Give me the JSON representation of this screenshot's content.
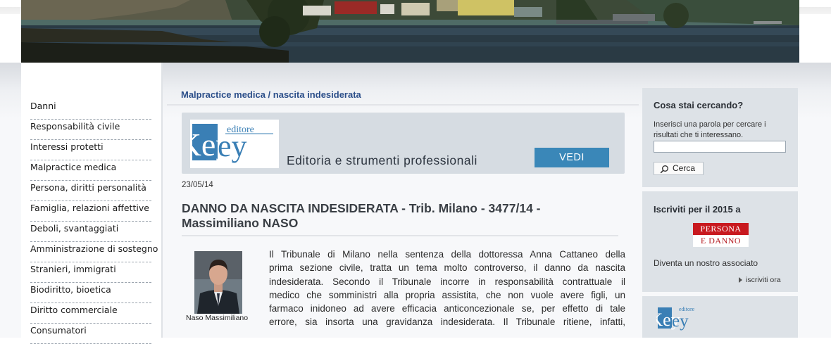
{
  "nav": {
    "items": [
      "Danni",
      "Responsabilità civile",
      "Interessi protetti",
      "Malpractice medica",
      "Persona, diritti personalità",
      "Famiglia, relazioni affettive",
      "Deboli, svantaggiati",
      "Amministrazione di sostegno",
      "Stranieri, immigrati",
      "Biodiritto, bioetica",
      "Diritto commerciale",
      "Consumatori"
    ]
  },
  "main": {
    "breadcrumb": "Malpractice medica / nascita indesiderata",
    "ad": {
      "logo_key": "Key",
      "logo_editore": "editore",
      "tagline": "Editoria e strumenti professionali",
      "button": "VEDI"
    },
    "date": "23/05/14",
    "title_line1": "DANNO DA NASCITA INDESIDERATA - Trib. Milano - 3477/14 -",
    "title_line2": "Massimiliano NASO",
    "photo_caption": "Naso Massimiliano",
    "body_lines": [
      "Il Tribunale di Milano nella sentenza della dottoressa Anna Cattaneo della",
      "prima sezione civile, tratta un tema molto controverso, il danno da nascita",
      "indesiderata. Secondo il Tribunale incorre in responsabilità contrattuale il",
      "medico che somministri alla propria assistita, che non vuole avere figli, un",
      "farmaco inidoneo ad avere efficacia anticoncezionale se, per effetto di tale",
      "errore, sia insorta una gravidanza indesiderata. Il Tribunale ritiene, infatti,"
    ]
  },
  "sidebar": {
    "search": {
      "title": "Cosa stai cercando?",
      "description": "Inserisci una parola per cercare i risultati che ti interessano.",
      "button": "Cerca",
      "value": ""
    },
    "subscribe": {
      "title": "Iscriviti per il 2015 a",
      "logo_top": "PERSONA",
      "logo_bottom": "E DANNO",
      "text": "Diventa un nostro associato",
      "link": "iscriviti ora"
    },
    "key_box": {
      "logo_key": "Key",
      "logo_editore": "editore"
    }
  },
  "colors": {
    "breadcrumb": "#2c4f8a",
    "ad_button": "#3a87b8",
    "sidebar_box": "#dde2e7",
    "key_logo": "#3a7fb5",
    "persona_red": "#c8191f"
  }
}
